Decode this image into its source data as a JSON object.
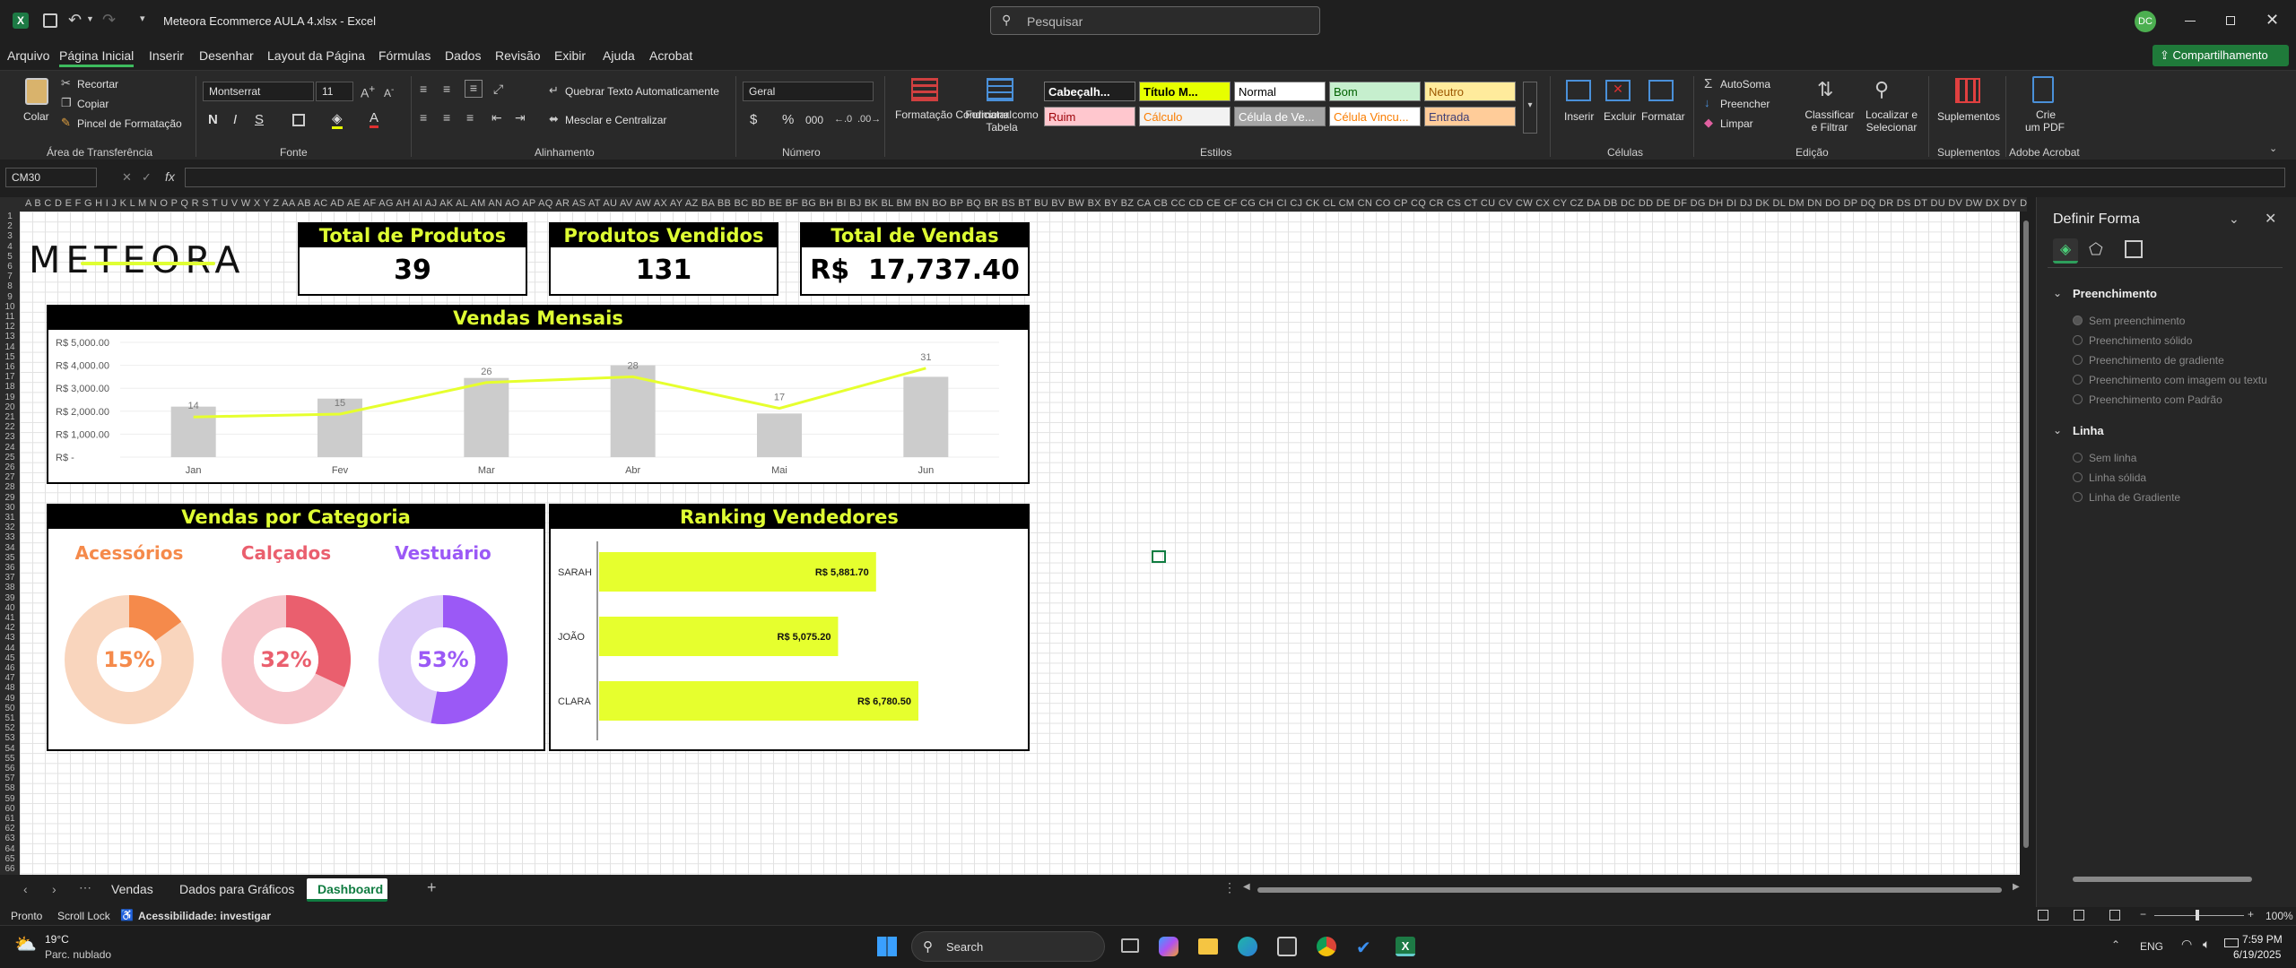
{
  "titlebar": {
    "filename": "Meteora Ecommerce AULA 4.xlsx",
    "separator": " - ",
    "app": "Excel",
    "search_placeholder": "Pesquisar",
    "avatar": "DC"
  },
  "menu": [
    "Arquivo",
    "Página Inicial",
    "Inserir",
    "Desenhar",
    "Layout da Página",
    "Fórmulas",
    "Dados",
    "Revisão",
    "Exibir",
    "Ajuda",
    "Acrobat"
  ],
  "share_label": "Compartilhamento",
  "ribbon": {
    "clipboard": {
      "paste": "Colar",
      "cut": "Recortar",
      "copy": "Copiar",
      "format_painter": "Pincel de Formatação",
      "group": "Área de Transferência"
    },
    "font": {
      "name": "Montserrat",
      "size": "11",
      "group": "Fonte",
      "bold": "N",
      "italic": "I",
      "underline": "S"
    },
    "alignment": {
      "wrap": "Quebrar Texto Automaticamente",
      "merge": "Mesclar e Centralizar",
      "group": "Alinhamento"
    },
    "number": {
      "format": "Geral",
      "currency": "$",
      "percent": "%",
      "comma": "000",
      "group": "Número"
    },
    "styles": {
      "cond_format": "Formatação Condicional",
      "format_table": "Formatar como Tabela",
      "cells": [
        {
          "label": "Cabeçalh...",
          "bg": "#1f1f1f",
          "fg": "#ffffff"
        },
        {
          "label": "Título M...",
          "bg": "#e6ff00",
          "fg": "#000000"
        },
        {
          "label": "Normal",
          "bg": "#ffffff",
          "fg": "#000000"
        },
        {
          "label": "Bom",
          "bg": "#c6efce",
          "fg": "#006100"
        },
        {
          "label": "Neutro",
          "bg": "#ffeb9c",
          "fg": "#9c5700"
        },
        {
          "label": "Ruim",
          "bg": "#ffc7ce",
          "fg": "#9c0006"
        },
        {
          "label": "Cálculo",
          "bg": "#f2f2f2",
          "fg": "#fa7d00"
        },
        {
          "label": "Célula de Ve...",
          "bg": "#a5a5a5",
          "fg": "#ffffff"
        },
        {
          "label": "Célula Vincu...",
          "bg": "#ffffff",
          "fg": "#fa7d00"
        },
        {
          "label": "Entrada",
          "bg": "#ffcc99",
          "fg": "#3f3f76"
        }
      ],
      "group": "Estilos"
    },
    "cells": {
      "insert": "Inserir",
      "delete": "Excluir",
      "format": "Formatar",
      "group": "Células"
    },
    "editing": {
      "autosum": "AutoSoma",
      "fill": "Preencher",
      "clear": "Limpar",
      "sort": "Classificar e Filtrar",
      "find": "Localizar e Selecionar",
      "group": "Edição"
    },
    "addins": {
      "label": "Suplementos",
      "group": "Suplementos"
    },
    "acrobat": {
      "label1": "Crie",
      "label2": "um PDF",
      "group": "Adobe Acrobat"
    }
  },
  "formula": {
    "namebox": "CM30",
    "fx": "fx",
    "value": ""
  },
  "columns": "A B C D E F G H I J K L M N O P Q R S T U V W X Y Z AA AB AC AD AE AF AG AH AI AJ AK AL AM AN AO AP AQ AR AS AT AU AV AW AX AY AZ BA BB BC BD BE BF BG BH BI BJ BK BL BM BN BO BP BQ BR BS BT BU BV BW BX BY BZ CA CB CC CD CE CF CG CH CI CJ CK CL CM CN CO CP CQ CR CS CT CU CV CW CX CY CZ DA DB DC DD DE DF DG DH DI DJ DK DL DM DN DO DP DQ DR DS DT DU DV DW DX DY DZ EA EB EC ED EE EF EG EH EI EJ EK EL EM EN EO EP EQ ER ES ET EU EV EW EX EY EZ FA FB FC",
  "dashboard": {
    "logo": "METEORA",
    "kpis": [
      {
        "title": "Total de Produtos",
        "value": "39"
      },
      {
        "title": "Produtos Vendidos",
        "value": "131"
      },
      {
        "title": "Total de Vendas",
        "value": "R$  17,737.40"
      }
    ],
    "monthly_title": "Vendas Mensais",
    "category_title": "Vendas por Categoria",
    "ranking_title": "Ranking Vendedores",
    "categories": [
      {
        "name": "Acessórios",
        "pct": "15%",
        "value": 0.15,
        "color": "#f58a4b",
        "light": "#f9d5bd"
      },
      {
        "name": "Calçados",
        "pct": "32%",
        "value": 0.32,
        "color": "#ea5f6e",
        "light": "#f6c4ca"
      },
      {
        "name": "Vestuário",
        "pct": "53%",
        "value": 0.53,
        "color": "#9b59f6",
        "light": "#dccaf9"
      }
    ]
  },
  "chart_data": [
    {
      "type": "bar",
      "title": "Vendas Mensais",
      "categories": [
        "Jan",
        "Fev",
        "Mar",
        "Abr",
        "Mai",
        "Jun"
      ],
      "yticks": [
        "R$ 5,000.00",
        "R$ 4,000.00",
        "R$ 3,000.00",
        "R$ 2,000.00",
        "R$ 1,000.00",
        "R$ -"
      ],
      "ylim": [
        0,
        5000
      ],
      "series": [
        {
          "type": "bar",
          "values": [
            2200,
            2550,
            3450,
            4000,
            1900,
            3500
          ],
          "color": "#cccccc"
        },
        {
          "type": "line",
          "values": [
            14,
            15,
            26,
            28,
            17,
            31
          ],
          "ylim": [
            0,
            40
          ],
          "color": "#e6ff2e"
        }
      ]
    },
    {
      "type": "bar",
      "title": "Ranking Vendedores",
      "orientation": "horizontal",
      "categories": [
        "SARAH",
        "JOÃO",
        "CLARA"
      ],
      "values": [
        5881.7,
        5075.2,
        6780.5
      ],
      "labels": [
        "R$ 5,881.70",
        "R$ 5,075.20",
        "R$ 6,780.50"
      ],
      "xlim": [
        0,
        8000
      ],
      "color": "#e6ff2e"
    }
  ],
  "sheet_tabs": [
    "Vendas",
    "Dados para Gráficos",
    "Dashboard"
  ],
  "active_tab": "Dashboard",
  "side_panel": {
    "title": "Definir Forma",
    "fill_header": "Preenchimento",
    "fill_options": [
      "Sem preenchimento",
      "Preenchimento sólido",
      "Preenchimento de gradiente",
      "Preenchimento com imagem ou textu",
      "Preenchimento com Padrão"
    ],
    "line_header": "Linha",
    "line_options": [
      "Sem linha",
      "Linha sólida",
      "Linha de Gradiente"
    ]
  },
  "status": {
    "ready": "Pronto",
    "scroll_lock": "Scroll Lock",
    "accessibility": "Acessibilidade: investigar",
    "zoom": "100%"
  },
  "taskbar": {
    "temp": "19°C",
    "weather": "Parc. nublado",
    "search": "Search",
    "lang": "ENG",
    "time": "7:59 PM",
    "date": "6/19/2025"
  }
}
